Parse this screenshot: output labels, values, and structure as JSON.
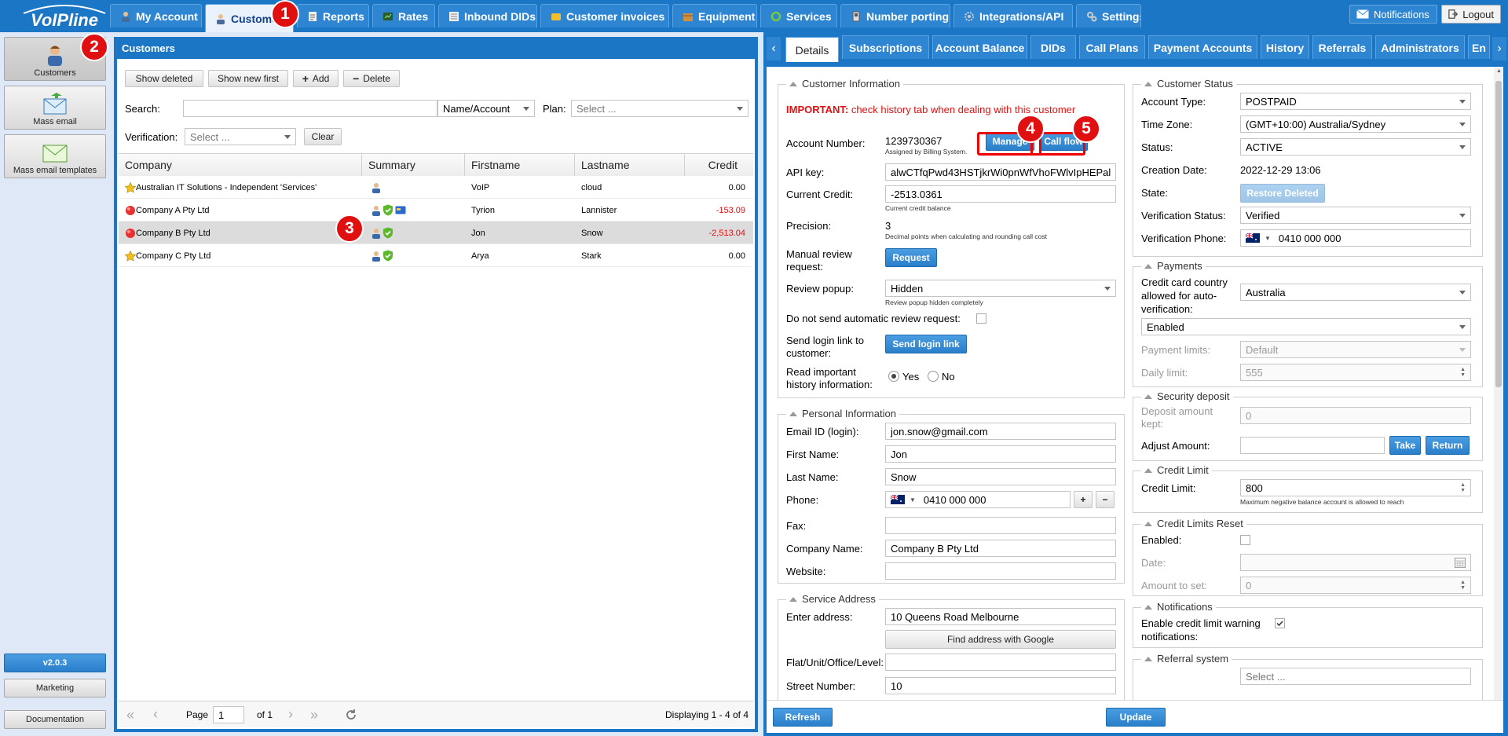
{
  "app": {
    "logo_text": "VoIPline"
  },
  "topnav": {
    "tabs": [
      {
        "label": "My Account",
        "icon": "user-icon"
      },
      {
        "label": "Customers",
        "icon": "user-icon"
      },
      {
        "label": "Reports",
        "icon": "report-icon"
      },
      {
        "label": "Rates",
        "icon": "rates-icon"
      },
      {
        "label": "Inbound DIDs",
        "icon": "list-icon"
      },
      {
        "label": "Customer invoices",
        "icon": "invoice-icon"
      },
      {
        "label": "Equipment",
        "icon": "box-icon"
      },
      {
        "label": "Services",
        "icon": "services-icon"
      },
      {
        "label": "Number porting",
        "icon": "phone-icon"
      },
      {
        "label": "Integrations/API",
        "icon": "gear-icon"
      },
      {
        "label": "Settings",
        "icon": "settings-icon"
      }
    ],
    "notifications": "Notifications",
    "logout": "Logout"
  },
  "sidebar": {
    "items": [
      {
        "label": "Customers",
        "icon": "customer-icon"
      },
      {
        "label": "Mass email",
        "icon": "mass-email-icon"
      },
      {
        "label": "Mass email templates",
        "icon": "email-template-icon"
      }
    ],
    "version": "v2.0.3",
    "marketing": "Marketing",
    "documentation": "Documentation"
  },
  "customers": {
    "title": "Customers",
    "toolbar": {
      "show_deleted": "Show deleted",
      "show_new_first": "Show new first",
      "add": "Add",
      "delete": "Delete"
    },
    "search_label": "Search:",
    "search_mode": "Name/Account",
    "plan_label": "Plan:",
    "plan_placeholder": "Select ...",
    "verification_label": "Verification:",
    "verification_placeholder": "Select ...",
    "clear": "Clear",
    "columns": [
      "Company",
      "Summary",
      "Firstname",
      "Lastname",
      "Credit"
    ],
    "rows": [
      {
        "company": "Australian IT Solutions - Independent 'Services'",
        "status_icon": "star-icon",
        "firstname": "VoIP",
        "lastname": "cloud",
        "credit": "0.00",
        "negative": false,
        "summary": [
          "user-icon"
        ]
      },
      {
        "company": "Company A Pty Ltd",
        "status_icon": "red-dot-icon",
        "firstname": "Tyrion",
        "lastname": "Lannister",
        "credit": "-153.09",
        "negative": true,
        "summary": [
          "user-icon",
          "shield-check-icon",
          "card-icon"
        ]
      },
      {
        "company": "Company B Pty Ltd",
        "status_icon": "red-dot-icon",
        "firstname": "Jon",
        "lastname": "Snow",
        "credit": "-2,513.04",
        "negative": true,
        "summary": [
          "user-icon",
          "shield-check-icon"
        ]
      },
      {
        "company": "Company C Pty Ltd",
        "status_icon": "star-icon",
        "firstname": "Arya",
        "lastname": "Stark",
        "credit": "0.00",
        "negative": false,
        "summary": [
          "user-icon",
          "shield-check-icon"
        ]
      }
    ],
    "pager": {
      "page_label": "Page",
      "page": "1",
      "of": "of 1",
      "displaying": "Displaying 1 - 4 of 4"
    }
  },
  "details": {
    "tabs": [
      "Details",
      "Subscriptions",
      "Account Balance",
      "DIDs",
      "Call Plans",
      "Payment Accounts",
      "History",
      "Referrals",
      "Administrators",
      "En"
    ],
    "customer_info": {
      "legend": "Customer Information",
      "important_prefix": "IMPORTANT:",
      "important_text": "check history tab when dealing with this customer",
      "account_number_label": "Account Number:",
      "account_number": "1239730367",
      "account_note": "Assigned by Billing System.",
      "manage": "Manage",
      "call_flow": "Call flow",
      "api_key_label": "API key:",
      "api_key": "alwCTfqPwd43HSTjkrWi0pnWfVhoFWlvIpHEPal",
      "current_credit_label": "Current Credit:",
      "current_credit": "-2513.0361",
      "current_credit_note": "Current credit balance",
      "precision_label": "Precision:",
      "precision": "3",
      "precision_note": "Decimal points when calculating and rounding call cost",
      "manual_review_label_1": "Manual review",
      "manual_review_label_2": "request:",
      "request": "Request",
      "review_popup_label": "Review popup:",
      "review_popup": "Hidden",
      "review_popup_note": "Review popup hidden completely",
      "no_auto_review_label": "Do not send automatic review request:",
      "send_login_label_1": "Send login link to",
      "send_login_label_2": "customer:",
      "send_login": "Send login link",
      "read_important_label_1": "Read important",
      "read_important_label_2": "history information:",
      "yes": "Yes",
      "no": "No"
    },
    "personal_info": {
      "legend": "Personal Information",
      "email_label": "Email ID (login):",
      "email": "jon.snow@gmail.com",
      "first_name_label": "First Name:",
      "first_name": "Jon",
      "last_name_label": "Last Name:",
      "last_name": "Snow",
      "phone_label": "Phone:",
      "phone": "0410 000 000",
      "fax_label": "Fax:",
      "fax": "",
      "company_label": "Company Name:",
      "company": "Company B Pty Ltd",
      "website_label": "Website:",
      "website": ""
    },
    "service_address": {
      "legend": "Service Address",
      "enter_address_label": "Enter address:",
      "enter_address": "10 Queens Road Melbourne",
      "find_google": "Find address with Google",
      "flat_label": "Flat/Unit/Office/Level:",
      "flat": "",
      "street_number_label": "Street Number:",
      "street_number": "10"
    },
    "customer_status": {
      "legend": "Customer Status",
      "account_type_label": "Account Type:",
      "account_type": "POSTPAID",
      "time_zone_label": "Time Zone:",
      "time_zone": "(GMT+10:00) Australia/Sydney",
      "status_label": "Status:",
      "status": "ACTIVE",
      "creation_date_label": "Creation Date:",
      "creation_date": "2022-12-29 13:06",
      "state_label": "State:",
      "restore_deleted": "Restore Deleted",
      "verification_status_label": "Verification Status:",
      "verification_status": "Verified",
      "verification_phone_label": "Verification Phone:",
      "verification_phone": "0410 000 000"
    },
    "payments": {
      "legend": "Payments",
      "cc_country_label_1": "Credit card country",
      "cc_country_label_2": "allowed for auto-",
      "cc_country_label_3": "verification:",
      "cc_country": "Australia",
      "enabled": "Enabled",
      "payment_limits_label": "Payment limits:",
      "payment_limits": "Default",
      "daily_limit_label": "Daily limit:",
      "daily_limit": "555"
    },
    "security_deposit": {
      "legend": "Security deposit",
      "deposit_label_1": "Deposit amount",
      "deposit_label_2": "kept:",
      "deposit": "0",
      "adjust_label": "Adjust Amount:",
      "take": "Take",
      "return": "Return"
    },
    "credit_limit": {
      "legend": "Credit Limit",
      "label": "Credit Limit:",
      "value": "800",
      "note": "Maximum negative balance account is allowed to reach"
    },
    "credit_limits_reset": {
      "legend": "Credit Limits Reset",
      "enabled_label": "Enabled:",
      "date_label": "Date:",
      "amount_label": "Amount to set:",
      "amount": "0"
    },
    "notifications": {
      "legend": "Notifications",
      "label_1": "Enable credit limit warning",
      "label_2": "notifications:"
    },
    "referral": {
      "legend": "Referral system",
      "placeholder": "Select ..."
    },
    "refresh": "Refresh",
    "update": "Update"
  },
  "callouts": [
    "1",
    "2",
    "3",
    "4",
    "5"
  ],
  "colors": {
    "brand": "#1b77c5",
    "negative": "#e01010",
    "callout": "#e01010"
  }
}
